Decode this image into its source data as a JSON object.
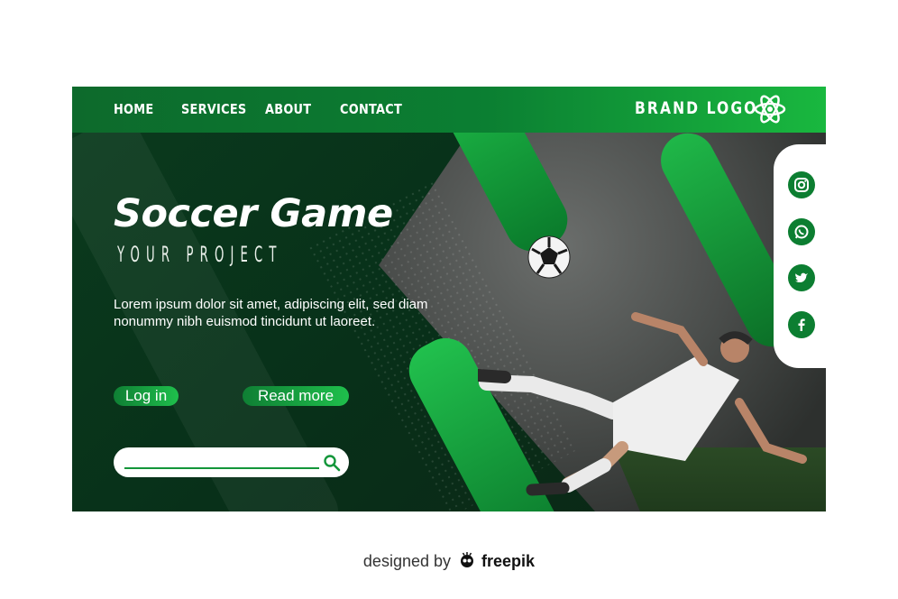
{
  "nav": {
    "items": [
      {
        "label": "HOME"
      },
      {
        "label": "SERVICES"
      },
      {
        "label": "ABOUT"
      },
      {
        "label": "CONTACT"
      }
    ],
    "brand_label": "BRAND LOGO",
    "brand_icon": "atom-icon"
  },
  "hero": {
    "title": "Soccer Game",
    "subtitle": "YOUR PROJECT",
    "description": "Lorem ipsum dolor sit amet, adipiscing elit, sed diam nonummy nibh euismod tincidunt ut laoreet.",
    "login_label": "Log in",
    "read_more_label": "Read more"
  },
  "search": {
    "value": "",
    "icon": "search-icon"
  },
  "social": [
    {
      "name": "instagram-icon"
    },
    {
      "name": "whatsapp-icon"
    },
    {
      "name": "twitter-icon"
    },
    {
      "name": "facebook-icon"
    }
  ],
  "footer": {
    "prefix": "designed by",
    "brand": "freepik"
  },
  "colors": {
    "accent": "#0c7e31",
    "accent_light": "#1fbf4c",
    "dark_bg": "#0a2a16"
  }
}
